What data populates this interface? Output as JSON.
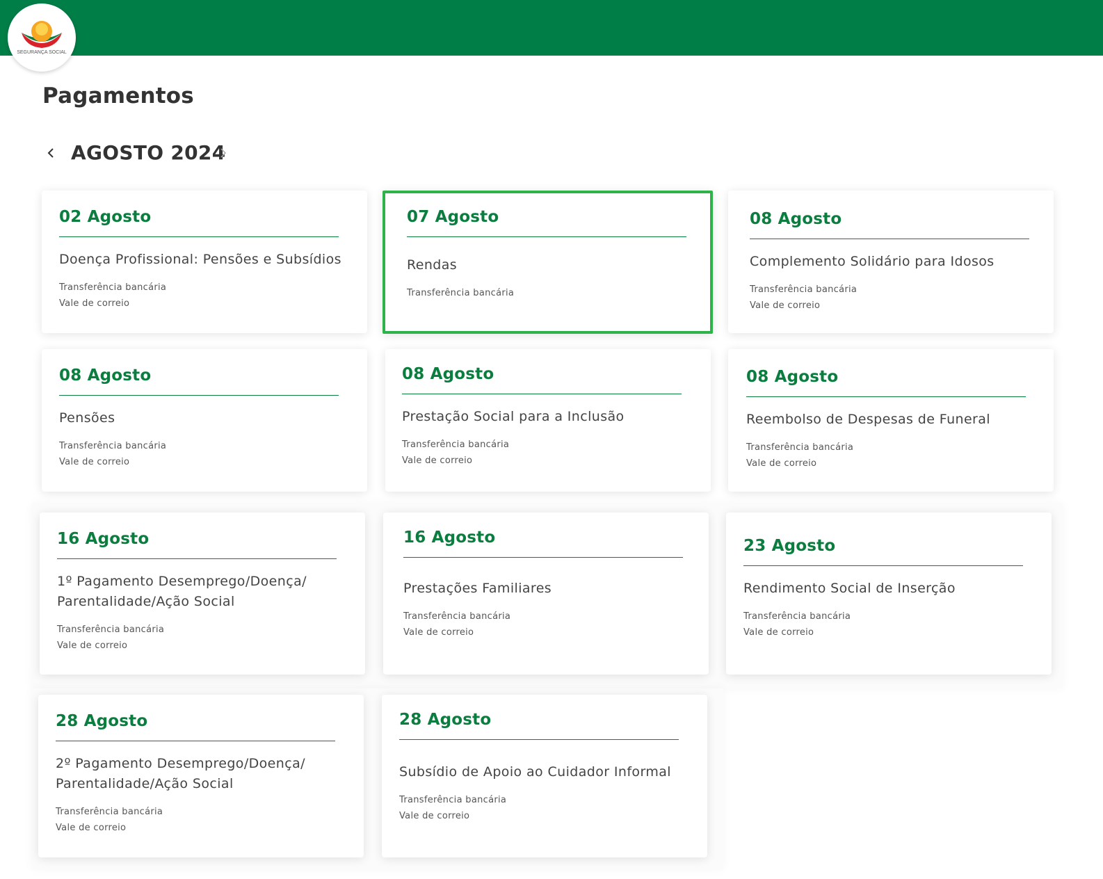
{
  "header": {
    "logo_text": "SEGURANÇA SOCIAL",
    "brand_color": "#007e47"
  },
  "page": {
    "title": "Pagamentos"
  },
  "calendar": {
    "month_label": "AGOSTO 2024",
    "prev_icon": "chevron-left-icon",
    "next_icon": "chevron-right-icon"
  },
  "colors": {
    "accent_green": "#0a7d3f",
    "selected_border": "#2db34a"
  },
  "payments": [
    {
      "date": "02 Agosto",
      "title": "Doença Profissional: Pensões e Subsídios",
      "methods": [
        "Transferência bancária",
        "Vale de correio"
      ],
      "selected": false
    },
    {
      "date": "07 Agosto",
      "title": "Rendas",
      "methods": [
        "Transferência bancária"
      ],
      "selected": true
    },
    {
      "date": "08 Agosto",
      "title": "Complemento Solidário para Idosos",
      "methods": [
        "Transferência bancária",
        "Vale de correio"
      ],
      "selected": false
    },
    {
      "date": "08 Agosto",
      "title": "Pensões",
      "methods": [
        "Transferência bancária",
        "Vale de correio"
      ],
      "selected": false
    },
    {
      "date": "08 Agosto",
      "title": "Prestação Social para a Inclusão",
      "methods": [
        "Transferência bancária",
        "Vale de correio"
      ],
      "selected": false
    },
    {
      "date": "08 Agosto",
      "title": "Reembolso de Despesas de Funeral",
      "methods": [
        "Transferência bancária",
        "Vale de correio"
      ],
      "selected": false
    },
    {
      "date": "16 Agosto",
      "title": "1º Pagamento Desemprego/Doença/ Parentalidade/Ação Social",
      "methods": [
        "Transferência bancária",
        "Vale de correio"
      ],
      "selected": false
    },
    {
      "date": "16 Agosto",
      "title": "Prestações Familiares",
      "methods": [
        "Transferência bancária",
        "Vale de correio"
      ],
      "selected": false
    },
    {
      "date": "23 Agosto",
      "title": "Rendimento Social de Inserção",
      "methods": [
        "Transferência bancária",
        "Vale de correio"
      ],
      "selected": false
    },
    {
      "date": "28 Agosto",
      "title": "2º Pagamento Desemprego/Doença/ Parentalidade/Ação Social",
      "methods": [
        "Transferência bancária",
        "Vale de correio"
      ],
      "selected": false
    },
    {
      "date": "28 Agosto",
      "title": "Subsídio de Apoio ao Cuidador Informal",
      "methods": [
        "Transferência bancária",
        "Vale de correio"
      ],
      "selected": false
    }
  ]
}
